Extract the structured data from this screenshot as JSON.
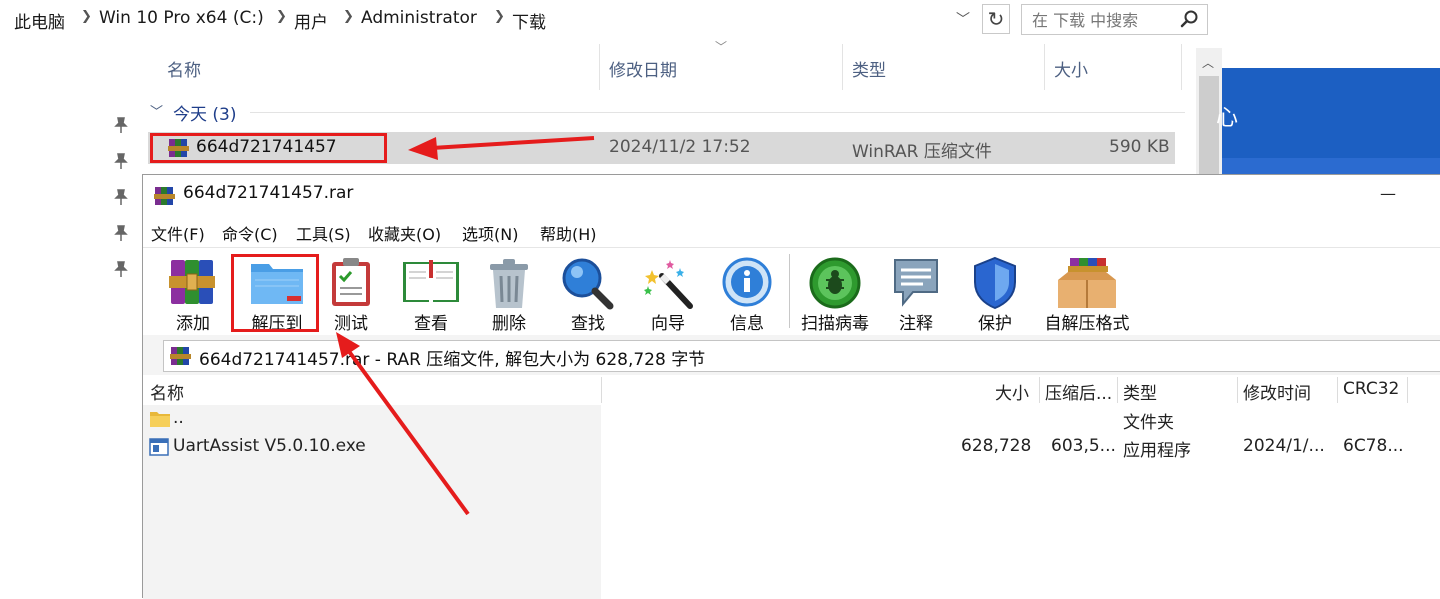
{
  "explorer": {
    "breadcrumb": [
      "此电脑",
      "Win 10 Pro x64 (C:)",
      "用户",
      "Administrator",
      "下载"
    ],
    "search_placeholder": "在 下载 中搜索",
    "columns": {
      "name": "名称",
      "modified": "修改日期",
      "type": "类型",
      "size": "大小"
    },
    "group_label": "今天 (3)",
    "file": {
      "name": "664d721741457",
      "modified": "2024/11/2 17:52",
      "type": "WinRAR 压缩文件",
      "size": "590 KB"
    }
  },
  "background_window": {
    "text": "心"
  },
  "winrar": {
    "title": "664d721741457.rar",
    "menu": [
      "文件(F)",
      "命令(C)",
      "工具(S)",
      "收藏夹(O)",
      "选项(N)",
      "帮助(H)"
    ],
    "toolbar": [
      {
        "label": "添加",
        "icon": "add-archive-icon"
      },
      {
        "label": "解压到",
        "icon": "extract-to-folder-icon"
      },
      {
        "label": "测试",
        "icon": "test-clipboard-icon"
      },
      {
        "label": "查看",
        "icon": "view-book-icon"
      },
      {
        "label": "删除",
        "icon": "trash-icon"
      },
      {
        "label": "查找",
        "icon": "magnifier-icon"
      },
      {
        "label": "向导",
        "icon": "magic-wand-icon"
      },
      {
        "label": "信息",
        "icon": "info-icon"
      },
      {
        "label": "扫描病毒",
        "icon": "virus-scan-icon"
      },
      {
        "label": "注释",
        "icon": "comment-icon"
      },
      {
        "label": "保护",
        "icon": "shield-icon"
      },
      {
        "label": "自解压格式",
        "icon": "sfx-box-icon"
      }
    ],
    "path_text": "664d721741457.rar - RAR 压缩文件, 解包大小为 628,728 字节",
    "list_columns": {
      "name": "名称",
      "size": "大小",
      "packed": "压缩后...",
      "type": "类型",
      "modified": "修改时间",
      "crc": "CRC32"
    },
    "rows": [
      {
        "name": "..",
        "size": "",
        "packed": "",
        "type": "文件夹",
        "modified": "",
        "crc": ""
      },
      {
        "name": "UartAssist V5.0.10.exe",
        "size": "628,728",
        "packed": "603,5...",
        "type": "应用程序",
        "modified": "2024/1/...",
        "crc": "6C78..."
      }
    ]
  }
}
